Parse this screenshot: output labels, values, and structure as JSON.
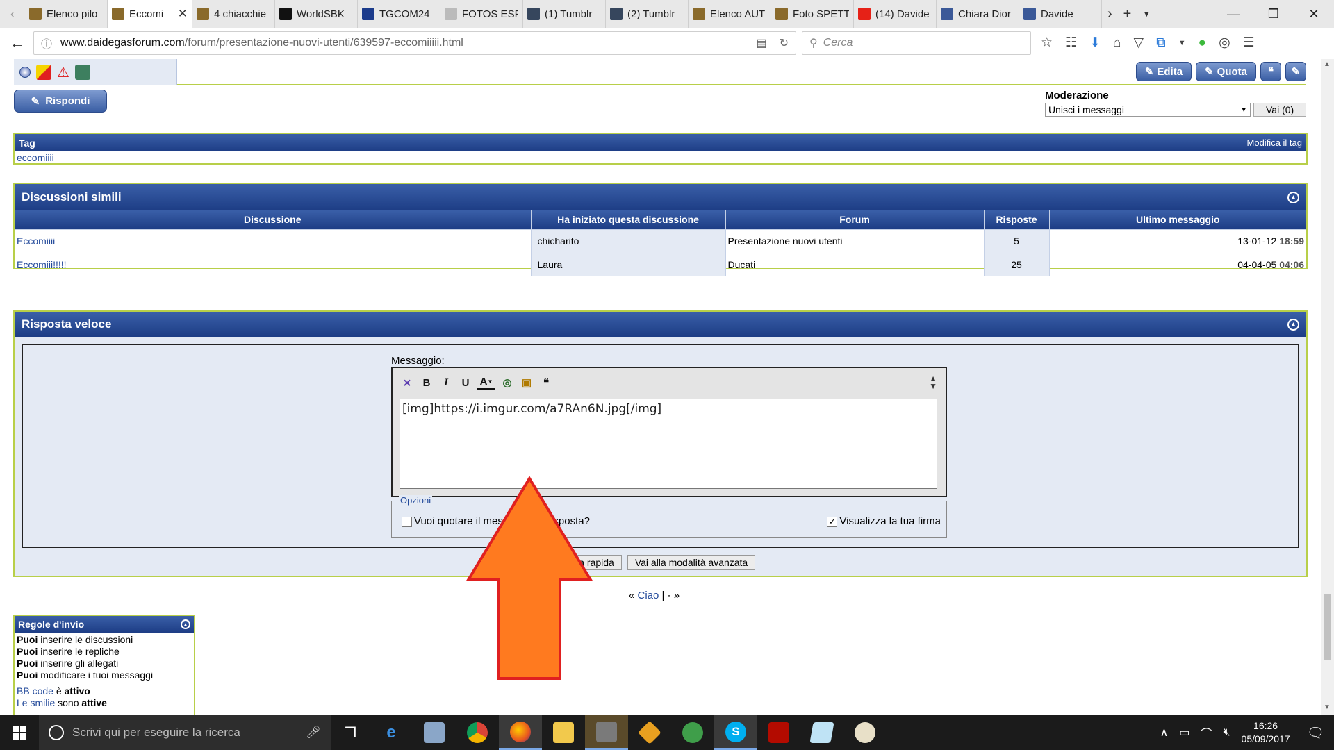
{
  "browser": {
    "tabs": [
      {
        "label": "Elenco pilo",
        "icon": "alert-favicon",
        "color": "#8a6a2b"
      },
      {
        "label": "Eccomi",
        "icon": "alert-favicon",
        "color": "#8a6a2b"
      },
      {
        "label": "4 chiacchie",
        "icon": "alert-favicon",
        "color": "#8a6a2b"
      },
      {
        "label": "WorldSBK",
        "icon": "sbk-favicon",
        "color": "#111111"
      },
      {
        "label": "TGCOM24",
        "icon": "tgcom-favicon",
        "color": "#1b3b8b"
      },
      {
        "label": "FOTOS ESP",
        "icon": "globe-favicon",
        "color": "#bbbbbb"
      },
      {
        "label": "(1) Tumblr",
        "icon": "tumblr-favicon",
        "color": "#36465d"
      },
      {
        "label": "(2) Tumblr",
        "icon": "tumblr-favicon",
        "color": "#36465d"
      },
      {
        "label": "Elenco AUT",
        "icon": "alert-favicon",
        "color": "#8a6a2b"
      },
      {
        "label": "Foto SPETT",
        "icon": "alert-favicon",
        "color": "#8a6a2b"
      },
      {
        "label": "(14) Davide",
        "icon": "youtube-favicon",
        "color": "#e62117"
      },
      {
        "label": "Chiara Dior",
        "icon": "facebook-favicon",
        "color": "#3b5998"
      },
      {
        "label": "Davide",
        "icon": "facebook-favicon",
        "color": "#3b5998"
      }
    ],
    "url_domain": "www.daidegasforum.com",
    "url_path": "/forum/presentazione-nuovi-utenti/639597-eccomiiiii.html",
    "search_placeholder": "Cerca"
  },
  "forum": {
    "top_buttons": {
      "edit": "Edita",
      "quote": "Quota"
    },
    "reply_button": "Rispondi",
    "moderation": {
      "title": "Moderazione",
      "selected": "Unisci i messaggi",
      "go_label": "Vai",
      "go_count": "(0)"
    },
    "tag": {
      "title": "Tag",
      "edit_link": "Modifica il tag",
      "value": "eccomiiii"
    },
    "similar": {
      "title": "Discussioni simili",
      "columns": [
        "Discussione",
        "Ha iniziato questa discussione",
        "Forum",
        "Risposte",
        "Ultimo messaggio"
      ],
      "rows": [
        {
          "title": "Eccomiiii",
          "starter": "chicharito",
          "forum": "Presentazione nuovi utenti",
          "replies": "5",
          "date": "13-01-12",
          "time": "18:59"
        },
        {
          "title": "Eccomiii!!!!!",
          "starter": "Laura",
          "forum": "Ducati",
          "replies": "25",
          "date": "04-04-05",
          "time": "04:06"
        }
      ]
    },
    "quick_reply": {
      "title": "Risposta veloce",
      "message_label": "Messaggio:",
      "message_value": "[img]https://i.imgur.com/a7RAn6N.jpg[/img]",
      "options_legend": "Opzioni",
      "option_quote": "Vuoi quotare il messaggio in risposta?",
      "option_signature": "Visualizza la tua firma",
      "submit_label": "Invia risposta rapida",
      "submit_visible": "risposta rapida",
      "advanced_label": "Vai alla modalità avanzata"
    },
    "pager": {
      "prev_symbol": "«",
      "prev_link": "Ciao",
      "sep": "|",
      "dash": "-",
      "next_symbol": "»"
    },
    "rules": {
      "title": "Regole d'invio",
      "items": [
        {
          "bold": "Puoi",
          "text": " inserire le discussioni"
        },
        {
          "bold": "Puoi",
          "text": " inserire le repliche"
        },
        {
          "bold": "Puoi",
          "text": " inserire gli allegati"
        },
        {
          "bold": "Puoi",
          "text": " modificare i tuoi messaggi"
        }
      ],
      "bbcode_link": "BB code",
      "bbcode_state_prefix": " è ",
      "bbcode_state": "attivo",
      "smilies_link": "Le smilie",
      "smilies_state_prefix": " sono ",
      "smilies_state": "attive"
    }
  },
  "taskbar": {
    "search_placeholder": "Scrivi qui per eseguire la ricerca",
    "time": "16:26",
    "date": "05/09/2017"
  },
  "colors": {
    "header_blue": "#1d3d85",
    "accent_green": "#b8cf49",
    "arrow_fill": "#ff7a1f",
    "arrow_stroke": "#e02020"
  }
}
